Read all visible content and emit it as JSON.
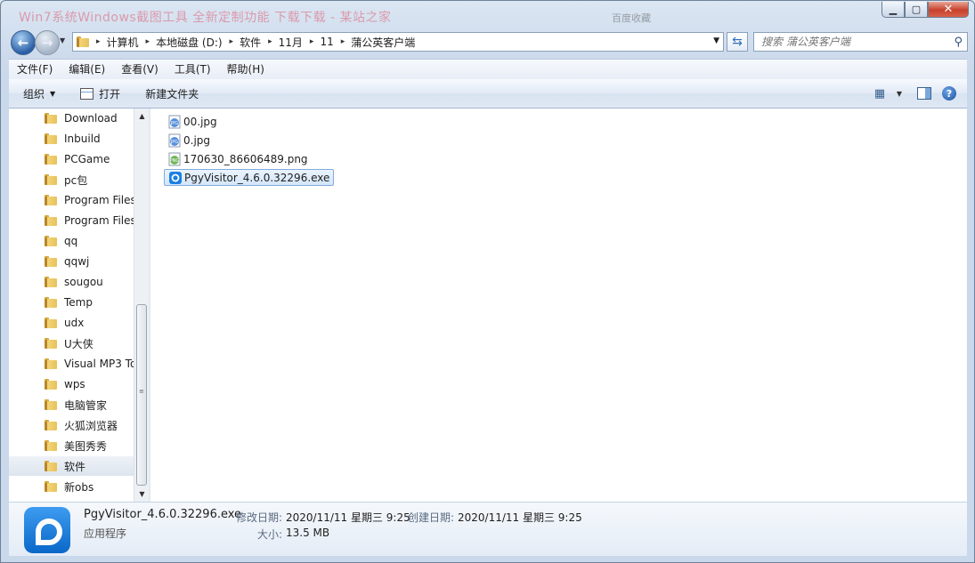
{
  "window": {
    "title_background": "Win7系统Windows截图工具 全新定制功能 下载下载 - 某站之家",
    "title_right": "百度收藏"
  },
  "address": {
    "crumbs": [
      "计算机",
      "本地磁盘 (D:)",
      "软件",
      "11月",
      "11",
      "蒲公英客户端"
    ]
  },
  "search": {
    "placeholder": "搜索 蒲公英客户端"
  },
  "menu": [
    "文件(F)",
    "编辑(E)",
    "查看(V)",
    "工具(T)",
    "帮助(H)"
  ],
  "toolbar": {
    "organize": "组织",
    "open": "打开",
    "new_folder": "新建文件夹"
  },
  "nav_items": [
    "Download",
    "Inbuild",
    "PCGame",
    "pc包",
    "Program Files",
    "Program Files",
    "qq",
    "qqwj",
    "sougou",
    "Temp",
    "udx",
    "U大侠",
    "Visual MP3 To",
    "wps",
    "电脑管家",
    "火狐浏览器",
    "美图秀秀",
    "软件",
    "新obs"
  ],
  "nav_selected_index": 17,
  "files": [
    {
      "name": "00.jpg",
      "type": "jpg"
    },
    {
      "name": "0.jpg",
      "type": "jpg"
    },
    {
      "name": "170630_86606489.png",
      "type": "png"
    },
    {
      "name": "PgyVisitor_4.6.0.32296.exe",
      "type": "exe"
    }
  ],
  "selected_file_index": 3,
  "details": {
    "name": "PgyVisitor_4.6.0.32296.exe",
    "type": "应用程序",
    "modified_label": "修改日期:",
    "modified": "2020/11/11 星期三 9:25",
    "created_label": "创建日期:",
    "created": "2020/11/11 星期三 9:25",
    "size_label": "大小:",
    "size": "13.5 MB"
  },
  "colors": {
    "accent": "#2a5fa5",
    "selection": "#d4e6fa",
    "app_icon": "#1a7fe0"
  }
}
